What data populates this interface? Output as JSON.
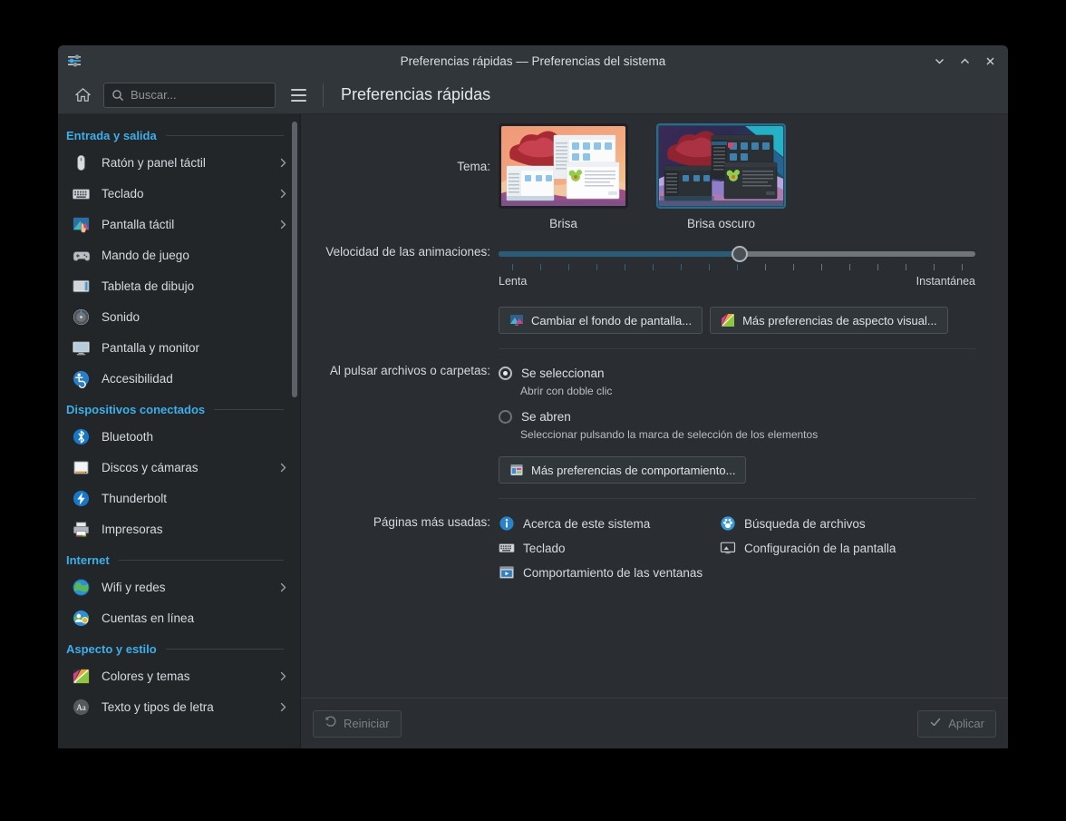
{
  "window": {
    "title": "Preferencias rápidas — Preferencias del sistema",
    "icon": "settings-sliders-icon",
    "controls": {
      "minimize": "minimize-icon",
      "maximize": "maximize-icon",
      "close": "close-icon"
    }
  },
  "toolbar": {
    "home_icon": "home-icon",
    "search": {
      "placeholder": "Buscar...",
      "value": "",
      "icon": "search-icon"
    },
    "menu_icon": "hamburger-menu-icon",
    "page_title": "Preferencias rápidas"
  },
  "sidebar": {
    "groups": [
      {
        "title": "Entrada y salida",
        "items": [
          {
            "label": "Ratón y panel táctil",
            "icon": "mouse-icon",
            "has_arrow": true
          },
          {
            "label": "Teclado",
            "icon": "keyboard-icon",
            "has_arrow": true
          },
          {
            "label": "Pantalla táctil",
            "icon": "touchscreen-icon",
            "has_arrow": true
          },
          {
            "label": "Mando de juego",
            "icon": "gamepad-icon",
            "has_arrow": false
          },
          {
            "label": "Tableta de dibujo",
            "icon": "drawing-tablet-icon",
            "has_arrow": false
          },
          {
            "label": "Sonido",
            "icon": "sound-icon",
            "has_arrow": false
          },
          {
            "label": "Pantalla y monitor",
            "icon": "display-icon",
            "has_arrow": false
          },
          {
            "label": "Accesibilidad",
            "icon": "accessibility-icon",
            "has_arrow": false
          }
        ]
      },
      {
        "title": "Dispositivos conectados",
        "items": [
          {
            "label": "Bluetooth",
            "icon": "bluetooth-icon",
            "has_arrow": false
          },
          {
            "label": "Discos y cámaras",
            "icon": "disks-icon",
            "has_arrow": true
          },
          {
            "label": "Thunderbolt",
            "icon": "thunderbolt-icon",
            "has_arrow": false
          },
          {
            "label": "Impresoras",
            "icon": "printer-icon",
            "has_arrow": false
          }
        ]
      },
      {
        "title": "Internet",
        "items": [
          {
            "label": "Wifi y redes",
            "icon": "globe-network-icon",
            "has_arrow": true
          },
          {
            "label": "Cuentas en línea",
            "icon": "online-accounts-icon",
            "has_arrow": false
          }
        ]
      },
      {
        "title": "Aspecto y estilo",
        "items": [
          {
            "label": "Colores y temas",
            "icon": "colors-themes-icon",
            "has_arrow": true
          },
          {
            "label": "Texto y tipos de letra",
            "icon": "fonts-icon",
            "has_arrow": true
          }
        ]
      }
    ]
  },
  "main": {
    "theme": {
      "label": "Tema:",
      "options": [
        {
          "name": "Brisa",
          "selected": false
        },
        {
          "name": "Brisa oscuro",
          "selected": true
        }
      ]
    },
    "animation_speed": {
      "label": "Velocidad de las animaciones:",
      "value_percent": 50,
      "min_label": "Lenta",
      "max_label": "Instantánea",
      "tick_count": 17
    },
    "appearance_buttons": [
      {
        "label": "Cambiar el fondo de pantalla...",
        "icon": "wallpaper-icon"
      },
      {
        "label": "Más preferencias de aspecto visual...",
        "icon": "appearance-icon"
      }
    ],
    "click_behavior": {
      "label": "Al pulsar archivos o carpetas:",
      "options": [
        {
          "label": "Se seleccionan",
          "sub": "Abrir con doble clic",
          "selected": true
        },
        {
          "label": "Se abren",
          "sub": "Seleccionar pulsando la marca de selección de los elementos",
          "selected": false
        }
      ],
      "more_button": {
        "label": "Más preferencias de comportamiento...",
        "icon": "behavior-icon"
      }
    },
    "most_used": {
      "label": "Páginas más usadas:",
      "links": [
        {
          "label": "Acerca de este sistema",
          "icon": "info-icon"
        },
        {
          "label": "Búsqueda de archivos",
          "icon": "file-search-icon"
        },
        {
          "label": "Teclado",
          "icon": "keyboard-icon"
        },
        {
          "label": "Configuración de la pantalla",
          "icon": "display-config-icon"
        },
        {
          "label": "Comportamiento de las ventanas",
          "icon": "window-behavior-icon"
        }
      ]
    }
  },
  "footer": {
    "reset": {
      "label": "Reiniciar",
      "icon": "undo-icon",
      "enabled": false
    },
    "apply": {
      "label": "Aplicar",
      "icon": "checkmark-icon",
      "enabled": false
    }
  },
  "colors": {
    "accent": "#3daee9",
    "window_bg": "#2a2e32",
    "sidebar_bg": "#232629",
    "titlebar_bg": "#31363b",
    "slider_fill": "#2a5c78"
  }
}
